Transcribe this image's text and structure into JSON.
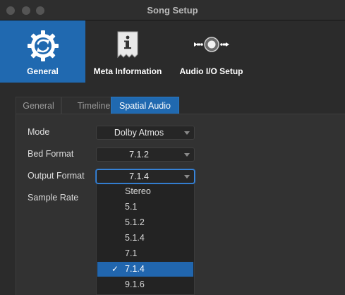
{
  "window": {
    "title": "Song Setup"
  },
  "toolbar": {
    "items": [
      {
        "label": "General",
        "icon": "gear-refresh-icon",
        "active": true
      },
      {
        "label": "Meta Information",
        "icon": "info-document-icon",
        "active": false
      },
      {
        "label": "Audio I/O Setup",
        "icon": "audio-io-icon",
        "active": false
      }
    ]
  },
  "tabs": [
    {
      "label": "General",
      "active": false
    },
    {
      "label": "Timeline",
      "active": false
    },
    {
      "label": "Spatial Audio",
      "active": true
    }
  ],
  "form": {
    "mode": {
      "label": "Mode",
      "value": "Dolby Atmos"
    },
    "bed_format": {
      "label": "Bed Format",
      "value": "7.1.2"
    },
    "output_format": {
      "label": "Output Format",
      "value": "7.1.4"
    },
    "sample_rate": {
      "label": "Sample Rate"
    }
  },
  "dropdown": {
    "options": [
      "Stereo",
      "5.1",
      "5.1.2",
      "5.1.4",
      "7.1",
      "7.1.4",
      "9.1.6"
    ],
    "selected": "7.1.4",
    "check_glyph": "✓"
  },
  "colors": {
    "accent": "#2069b0",
    "background": "#2b2b2b"
  }
}
